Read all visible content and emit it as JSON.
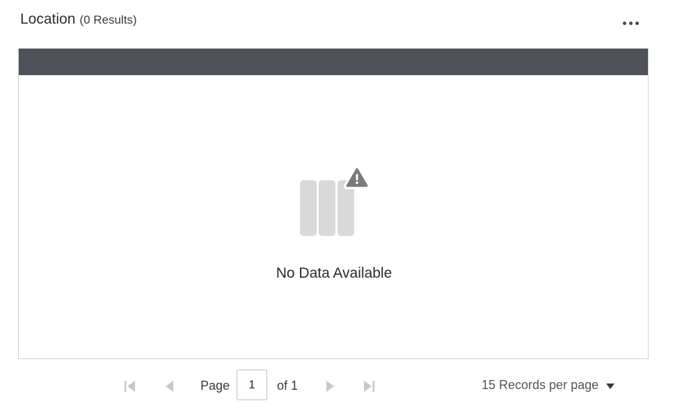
{
  "header": {
    "title": "Location",
    "count": "(0 Results)"
  },
  "table": {
    "empty_message": "No Data Available"
  },
  "pager": {
    "page_label": "Page",
    "current_page": "1",
    "of_label": "of 1",
    "records_per_page": "15 Records per page"
  },
  "icons": {
    "more": "more-horizontal-icon",
    "empty": "no-data-columns-warning-icon",
    "first": "first-page-icon",
    "prev": "previous-page-icon",
    "next": "next-page-icon",
    "last": "last-page-icon",
    "caret": "caret-down-icon"
  },
  "colors": {
    "table_header": "#4e5159",
    "border": "#cfcfcf",
    "empty_icon": "#d9d9d9",
    "warning_icon": "#7a7a7a",
    "disabled_nav": "#c8c8c8"
  }
}
